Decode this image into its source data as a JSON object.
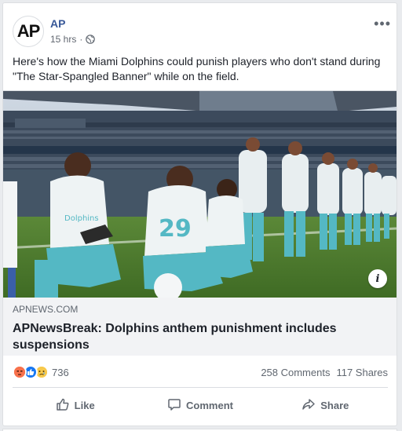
{
  "post": {
    "author": "AP",
    "avatar_text": "AP",
    "timestamp": "15 hrs",
    "separator": "·",
    "text": "Here's how the Miami Dolphins could punish players who don't stand during \"The Star-Spangled Banner\" while on the field."
  },
  "link": {
    "domain": "APNEWS.COM",
    "headline": "APNewsBreak: Dolphins anthem punishment includes suspensions",
    "info_label": "i"
  },
  "engagement": {
    "reaction_count": "736",
    "reactions": [
      "angry",
      "like",
      "sad"
    ],
    "comments": "258 Comments",
    "shares": "117 Shares"
  },
  "actions": {
    "like": "Like",
    "comment": "Comment",
    "share": "Share"
  },
  "colors": {
    "author": "#385898",
    "like_blue": "#1877f2",
    "angry": "#f7714c",
    "sad": "#f7c94c",
    "jersey_teal": "#54b8c4"
  },
  "icons": {
    "menu": "more-horizontal-icon",
    "privacy": "globe-icon",
    "like": "thumbs-up-icon",
    "comment": "speech-bubble-icon",
    "share": "share-arrow-icon"
  }
}
